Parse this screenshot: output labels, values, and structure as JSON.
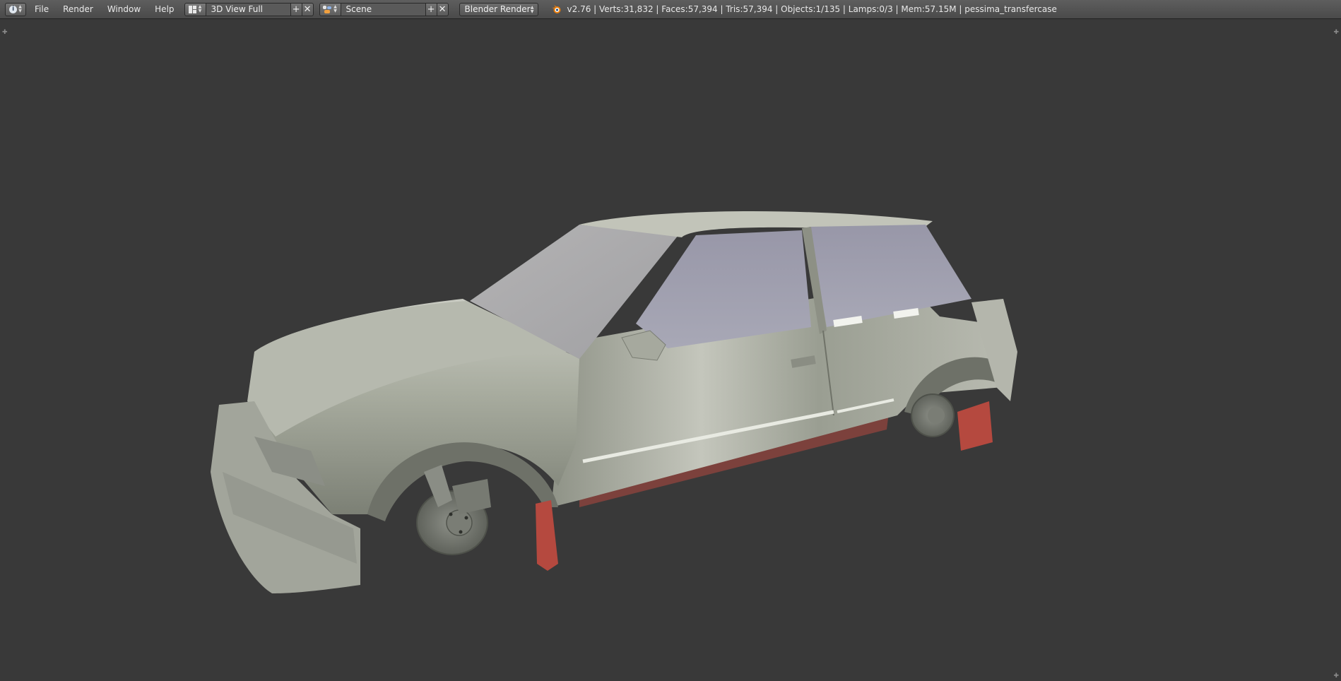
{
  "header": {
    "editor_type_icon": "info-icon",
    "menus": [
      "File",
      "Render",
      "Window",
      "Help"
    ],
    "screen_layout": {
      "icon": "screen-layout-icon",
      "value": "3D View Full"
    },
    "scene": {
      "icon": "scene-icon",
      "value": "Scene"
    },
    "render_engine": "Blender Render",
    "logo": "blender-logo-icon",
    "stats": "v2.76 | Verts:31,832 | Faces:57,394 | Tris:57,394 | Objects:1/135 | Lamps:0/3 | Mem:57.15M | pessima_transfercase"
  },
  "viewport": {
    "background_color": "#393939",
    "model_color": "#a8aca0",
    "accent_color": "#b5493f"
  }
}
